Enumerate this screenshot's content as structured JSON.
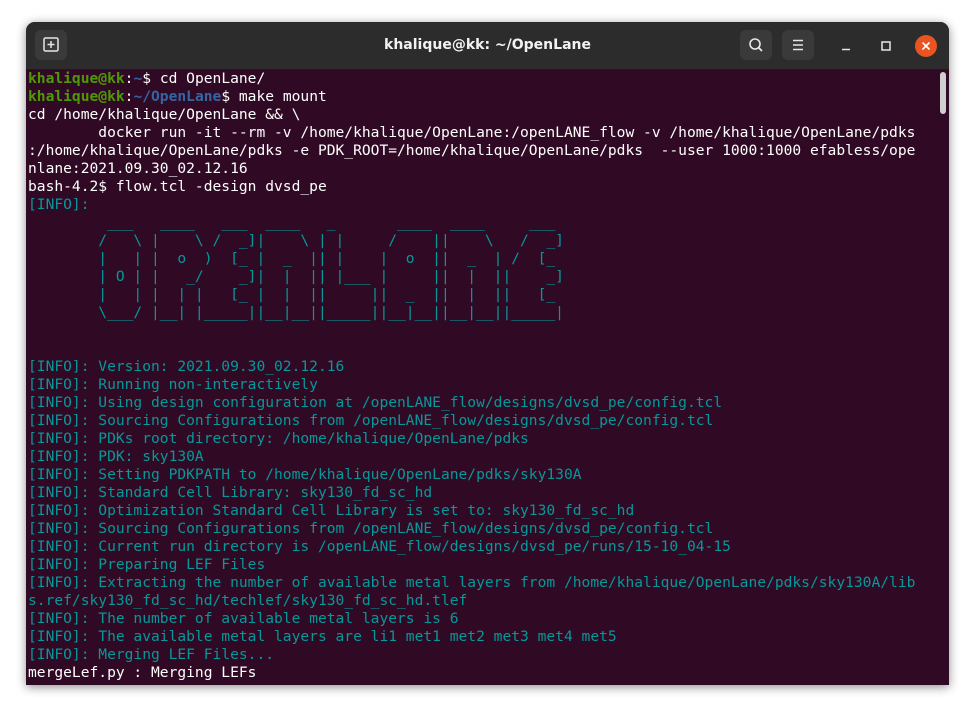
{
  "window": {
    "title": "khalique@kk: ~/OpenLane"
  },
  "icons": {
    "new_tab": "new-tab-icon",
    "search": "search-icon",
    "menu": "hamburger-menu-icon",
    "minimize": "minimize-icon",
    "maximize": "maximize-icon",
    "close": "close-icon"
  },
  "colors": {
    "terminal_bg": "#300a24",
    "prompt_user": "#4e9a06",
    "prompt_path": "#3465a4",
    "info_text": "#06989a",
    "close_button": "#e95420"
  },
  "terminal": {
    "lines": [
      {
        "parts": [
          {
            "t": "khalique@kk",
            "c": "g"
          },
          {
            "t": ":",
            "c": "w"
          },
          {
            "t": "~",
            "c": "b"
          },
          {
            "t": "$ cd OpenLane/",
            "c": "w"
          }
        ]
      },
      {
        "parts": [
          {
            "t": "khalique@kk",
            "c": "g"
          },
          {
            "t": ":",
            "c": "w"
          },
          {
            "t": "~/OpenLane",
            "c": "b"
          },
          {
            "t": "$ make mount",
            "c": "w"
          }
        ]
      },
      {
        "parts": [
          {
            "t": "cd /home/khalique/OpenLane && \\",
            "c": "w"
          }
        ]
      },
      {
        "parts": [
          {
            "t": "        docker run -it --rm -v /home/khalique/OpenLane:/openLANE_flow -v /home/khalique/OpenLane/pdks",
            "c": "w"
          }
        ]
      },
      {
        "parts": [
          {
            "t": ":/home/khalique/OpenLane/pdks -e PDK_ROOT=/home/khalique/OpenLane/pdks  --user 1000:1000 efabless/ope",
            "c": "w"
          }
        ]
      },
      {
        "parts": [
          {
            "t": "nlane:2021.09.30_02.12.16",
            "c": "w"
          }
        ]
      },
      {
        "parts": [
          {
            "t": "bash-4.2$ flow.tcl -design dvsd_pe",
            "c": "w"
          }
        ]
      },
      {
        "parts": [
          {
            "t": "[INFO]:",
            "c": "c"
          }
        ]
      },
      {
        "parts": [
          {
            "t": "         ___   ____   ___  ____   _       ____  ____     ___",
            "c": "c"
          }
        ]
      },
      {
        "parts": [
          {
            "t": "        /   \\ |    \\ /  _]|    \\ | |     /    ||    \\   /  _]",
            "c": "c"
          }
        ]
      },
      {
        "parts": [
          {
            "t": "        |   | |  o  )  [_ |  _  || |    |  o  ||  _  | /  [_",
            "c": "c"
          }
        ]
      },
      {
        "parts": [
          {
            "t": "        | O | |   _/    _]|  |  || |___ |     ||  |  ||    _]",
            "c": "c"
          }
        ]
      },
      {
        "parts": [
          {
            "t": "        |   | |  | |   [_ |  |  ||     ||  _  ||  |  ||   [_",
            "c": "c"
          }
        ]
      },
      {
        "parts": [
          {
            "t": "        \\___/ |__| |_____||__|__||_____||__|__||__|__||_____|",
            "c": "c"
          }
        ]
      },
      {
        "parts": [
          {
            "t": "",
            "c": "c"
          }
        ]
      },
      {
        "parts": [
          {
            "t": "",
            "c": "c"
          }
        ]
      },
      {
        "parts": [
          {
            "t": "[INFO]: Version: 2021.09.30_02.12.16",
            "c": "c"
          }
        ]
      },
      {
        "parts": [
          {
            "t": "[INFO]: Running non-interactively",
            "c": "c"
          }
        ]
      },
      {
        "parts": [
          {
            "t": "[INFO]: Using design configuration at /openLANE_flow/designs/dvsd_pe/config.tcl",
            "c": "c"
          }
        ]
      },
      {
        "parts": [
          {
            "t": "[INFO]: Sourcing Configurations from /openLANE_flow/designs/dvsd_pe/config.tcl",
            "c": "c"
          }
        ]
      },
      {
        "parts": [
          {
            "t": "[INFO]: PDKs root directory: /home/khalique/OpenLane/pdks",
            "c": "c"
          }
        ]
      },
      {
        "parts": [
          {
            "t": "[INFO]: PDK: sky130A",
            "c": "c"
          }
        ]
      },
      {
        "parts": [
          {
            "t": "[INFO]: Setting PDKPATH to /home/khalique/OpenLane/pdks/sky130A",
            "c": "c"
          }
        ]
      },
      {
        "parts": [
          {
            "t": "[INFO]: Standard Cell Library: sky130_fd_sc_hd",
            "c": "c"
          }
        ]
      },
      {
        "parts": [
          {
            "t": "[INFO]: Optimization Standard Cell Library is set to: sky130_fd_sc_hd",
            "c": "c"
          }
        ]
      },
      {
        "parts": [
          {
            "t": "[INFO]: Sourcing Configurations from /openLANE_flow/designs/dvsd_pe/config.tcl",
            "c": "c"
          }
        ]
      },
      {
        "parts": [
          {
            "t": "[INFO]: Current run directory is /openLANE_flow/designs/dvsd_pe/runs/15-10_04-15",
            "c": "c"
          }
        ]
      },
      {
        "parts": [
          {
            "t": "[INFO]: Preparing LEF Files",
            "c": "c"
          }
        ]
      },
      {
        "parts": [
          {
            "t": "[INFO]: Extracting the number of available metal layers from /home/khalique/OpenLane/pdks/sky130A/lib",
            "c": "c"
          }
        ]
      },
      {
        "parts": [
          {
            "t": "s.ref/sky130_fd_sc_hd/techlef/sky130_fd_sc_hd.tlef",
            "c": "c"
          }
        ]
      },
      {
        "parts": [
          {
            "t": "[INFO]: The number of available metal layers is 6",
            "c": "c"
          }
        ]
      },
      {
        "parts": [
          {
            "t": "[INFO]: The available metal layers are li1 met1 met2 met3 met4 met5",
            "c": "c"
          }
        ]
      },
      {
        "parts": [
          {
            "t": "[INFO]: Merging LEF Files...",
            "c": "c"
          }
        ]
      },
      {
        "parts": [
          {
            "t": "mergeLef.py : Merging LEFs",
            "c": "w"
          }
        ]
      }
    ]
  }
}
